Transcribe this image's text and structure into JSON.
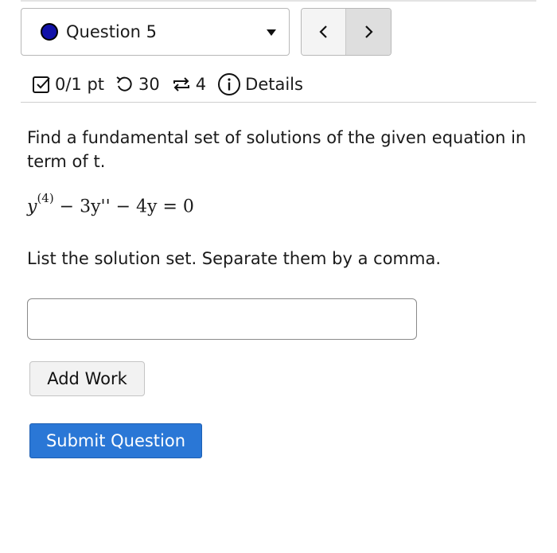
{
  "question_nav": {
    "title": "Question 5",
    "status_color": "#1111a8",
    "prev_icon": "chevron-left-icon",
    "next_icon": "chevron-right-icon"
  },
  "meta": {
    "score": "0/1 pt",
    "attempts": "30",
    "retries": "4",
    "details_label": "Details"
  },
  "question": {
    "prompt": "Find a fundamental set of solutions of the given equation in term of t.",
    "equation_base": "y",
    "equation_sup": "(4)",
    "equation_rest": " − 3y'' − 4y = 0",
    "instruction": "List the solution set. Separate them by a comma."
  },
  "answer": {
    "value": "",
    "placeholder": ""
  },
  "actions": {
    "add_work_label": "Add Work",
    "submit_label": "Submit Question",
    "submit_color": "#2a77d6"
  }
}
